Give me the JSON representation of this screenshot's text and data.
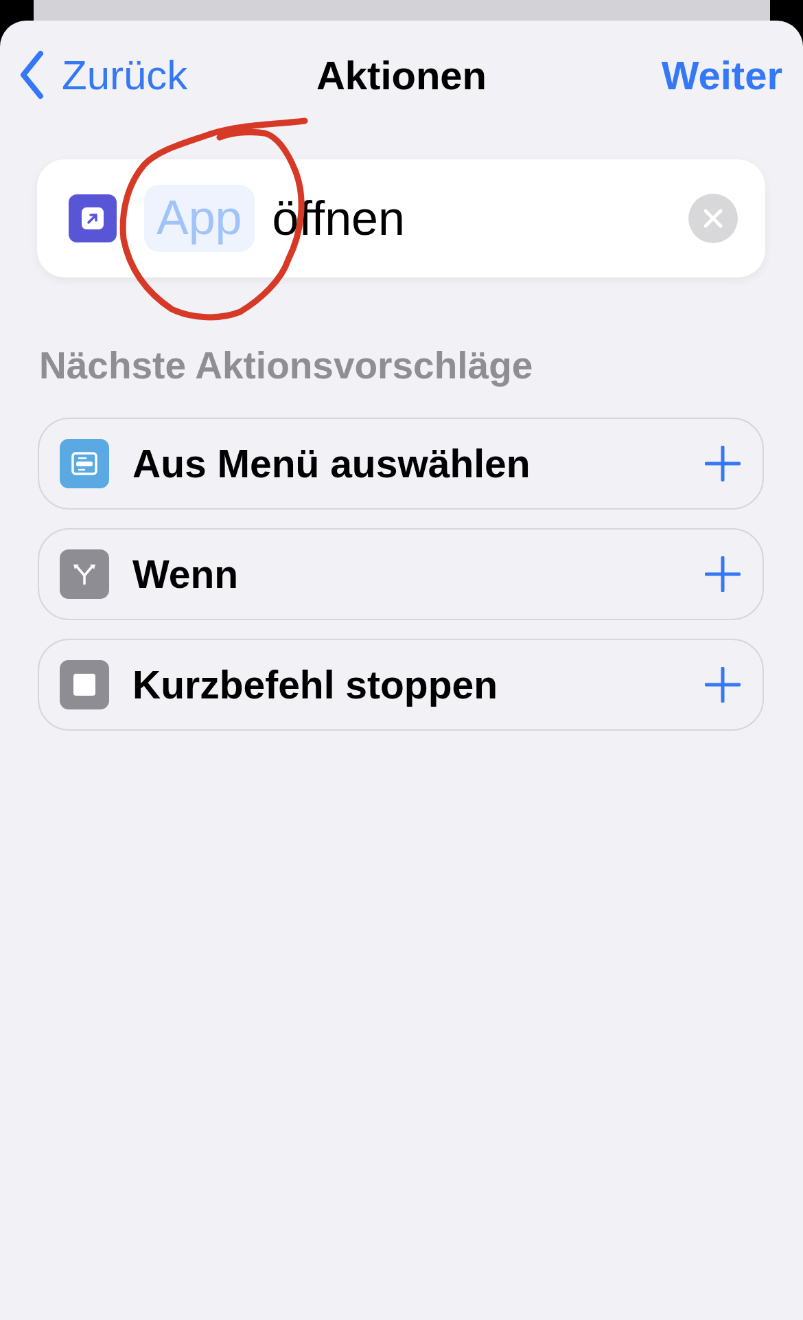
{
  "nav": {
    "back": "Zurück",
    "title": "Aktionen",
    "next": "Weiter"
  },
  "action": {
    "parameter": "App",
    "text": "öffnen"
  },
  "suggestions": {
    "heading": "Nächste Aktionsvorschläge",
    "items": [
      {
        "kind": "menu",
        "label": "Aus Menü auswählen",
        "color": "#5aa9e2"
      },
      {
        "kind": "branch",
        "label": "Wenn",
        "color": "#8e8d93"
      },
      {
        "kind": "stop",
        "label": "Kurzbefehl stoppen",
        "color": "#8e8d93"
      }
    ]
  }
}
